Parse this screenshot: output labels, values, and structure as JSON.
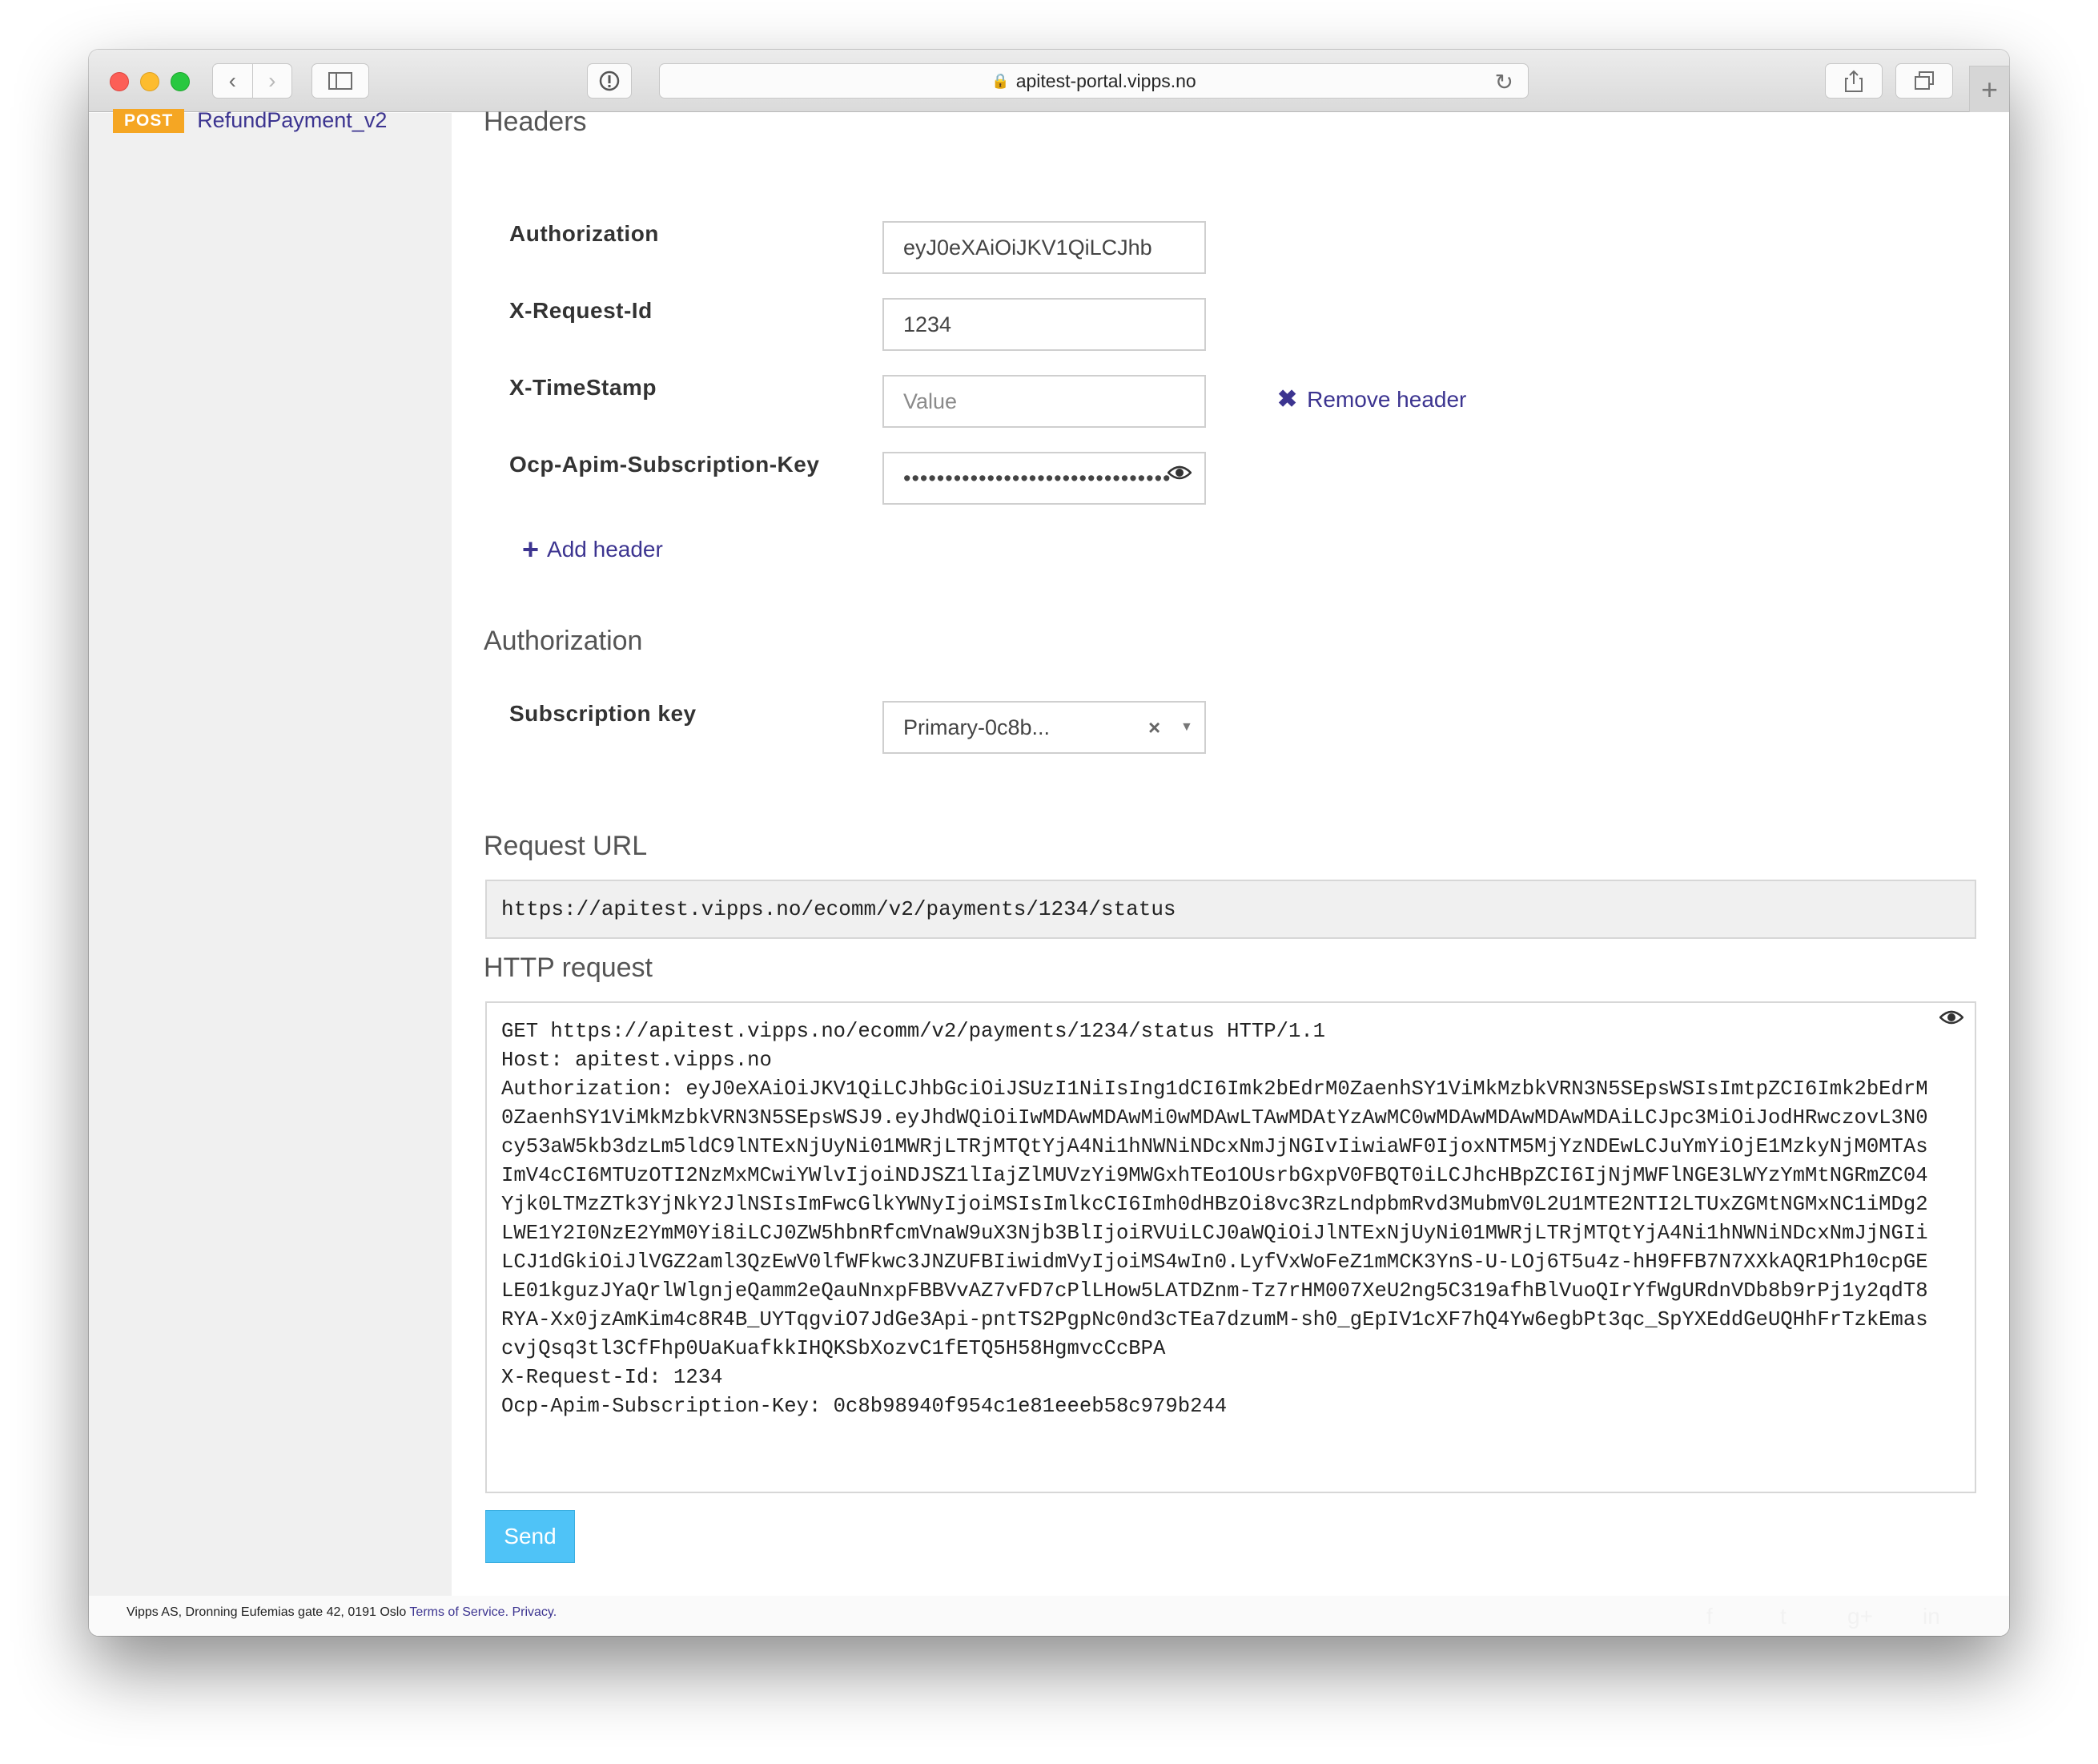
{
  "browser": {
    "url": "apitest-portal.vipps.no"
  },
  "sidebar": {
    "method_badge": "POST",
    "operation_name": "RefundPayment_v2"
  },
  "headers_section": {
    "title": "Headers",
    "fields": [
      {
        "label": "Authorization",
        "value": "eyJ0eXAiOiJKV1QiLCJhb",
        "placeholder": "Value"
      },
      {
        "label": "X-Request-Id",
        "value": "1234",
        "placeholder": "Value"
      },
      {
        "label": "X-TimeStamp",
        "value": "",
        "placeholder": "Value"
      },
      {
        "label": "Ocp-Apim-Subscription-Key",
        "value": "••••••••••••••••••••••••••••••••",
        "placeholder": "Value"
      }
    ],
    "remove_header_label": "Remove header",
    "add_header_label": "Add header"
  },
  "authorization_section": {
    "title": "Authorization",
    "subscription_label": "Subscription key",
    "subscription_value": "Primary-0c8b..."
  },
  "request_url": {
    "title": "Request URL",
    "value": "https://apitest.vipps.no/ecomm/v2/payments/1234/status"
  },
  "http_request": {
    "title": "HTTP request",
    "lines": [
      "GET https://apitest.vipps.no/ecomm/v2/payments/1234/status HTTP/1.1",
      "Host: apitest.vipps.no",
      "Authorization: eyJ0eXAiOiJKV1QiLCJhbGciOiJSUzI1NiIsIng1dCI6Imk2bEdrM0ZaenhSY1ViMkMzbkVRN3N5SEpsWSIsImtpZCI6Imk2bEdrM",
      "0ZaenhSY1ViMkMzbkVRN3N5SEpsWSJ9.eyJhdWQiOiIwMDAwMDAwMi0wMDAwLTAwMDAtYzAwMC0wMDAwMDAwMDAwMDAiLCJpc3MiOiJodHRwczovL3N0",
      "cy53aW5kb3dzLm5ldC9lNTExNjUyNi01MWRjLTRjMTQtYjA4Ni1hNWNiNDcxNmJjNGIvIiwiaWF0IjoxNTM5MjYzNDEwLCJuYmYiOjE1MzkyNjM0MTAs",
      "ImV4cCI6MTUzOTI2NzMxMCwiYWlvIjoiNDJSZ1lIajZlMUVzYi9MWGxhTEo1OUsrbGxpV0FBQT0iLCJhcHBpZCI6IjNjMWFlNGE3LWYzYmMtNGRmZC04",
      "Yjk0LTMzZTk3YjNkY2JlNSIsImFwcGlkYWNyIjoiMSIsImlkcCI6Imh0dHBzOi8vc3RzLndpbmRvd3MubmV0L2U1MTE2NTI2LTUxZGMtNGMxNC1iMDg2",
      "LWE1Y2I0NzE2YmM0Yi8iLCJ0ZW5hbnRfcmVnaW9uX3Njb3BlIjoiRVUiLCJ0aWQiOiJlNTExNjUyNi01MWRjLTRjMTQtYjA4Ni1hNWNiNDcxNmJjNGIi",
      "LCJ1dGkiOiJlVGZ2aml3QzEwV0lfWFkwc3JNZUFBIiwidmVyIjoiMS4wIn0.LyfVxWoFeZ1mMCK3YnS-U-LOj6T5u4z-hH9FFB7N7XXkAQR1Ph10cpGE",
      "LE01kguzJYaQrlWlgnjeQamm2eQauNnxpFBBVvAZ7vFD7cPlLHow5LATDZnm-Tz7rHM007XeU2ng5C319afhBlVuoQIrYfWgURdnVDb8b9rPj1y2qdT8",
      "RYA-Xx0jzAmKim4c8R4B_UYTqgviO7JdGe3Api-pntTS2PgpNc0nd3cTEa7dzumM-sh0_gEpIV1cXF7hQ4Yw6egbPt3qc_SpYXEddGeUQHhFrTzkEmas",
      "cvjQsq3tl3CfFhp0UaKuafkkIHQKSbXozvC1fETQ5H58HgmvcCcBPA",
      "X-Request-Id: 1234",
      "Ocp-Apim-Subscription-Key: 0c8b98940f954c1e81eeeb58c979b244"
    ]
  },
  "send_label": "Send",
  "footer": {
    "address": "Vipps AS, Dronning Eufemias gate 42, 0191 Oslo",
    "terms": "Terms of Service.",
    "privacy": "Privacy."
  },
  "icons": {
    "eye": "eye-icon",
    "remove": "close-icon",
    "add": "plus-icon",
    "lock": "lock-icon",
    "reload": "reload-icon"
  },
  "colors": {
    "accent": "#3c3490",
    "badge": "#f5a623",
    "send": "#4fc3f7"
  }
}
